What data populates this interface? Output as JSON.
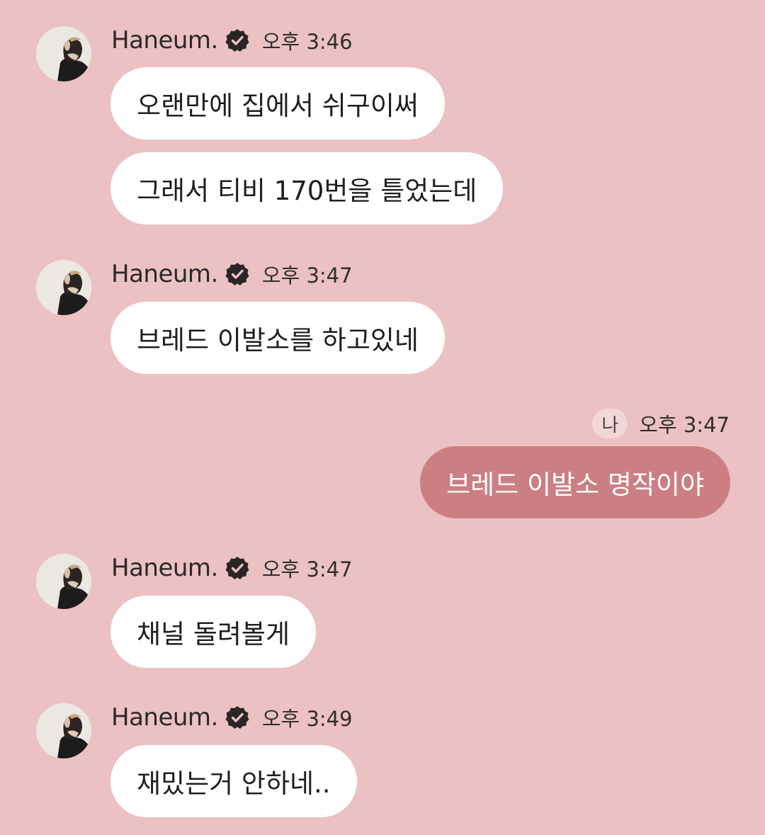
{
  "colors": {
    "background": "#ecc1c4",
    "incoming_bubble": "#ffffff",
    "outgoing_bubble": "#cc7f82",
    "me_label_bg": "#f3d6d8"
  },
  "messages": [
    {
      "sender": "Haneum.",
      "verified_icon": "verified-badge-icon",
      "time": "오후 3:46",
      "bubbles": [
        "오랜만에 집에서 쉬구이써",
        "그래서 티비 170번을 틀었는데"
      ]
    },
    {
      "sender": "Haneum.",
      "verified_icon": "verified-badge-icon",
      "time": "오후 3:47",
      "bubbles": [
        "브레드 이발소를 하고있네"
      ]
    },
    {
      "sender": "나",
      "time": "오후 3:47",
      "bubbles": [
        "브레드 이발소 명작이야"
      ]
    },
    {
      "sender": "Haneum.",
      "verified_icon": "verified-badge-icon",
      "time": "오후 3:47",
      "bubbles": [
        "채널 돌려볼게"
      ]
    },
    {
      "sender": "Haneum.",
      "verified_icon": "verified-badge-icon",
      "time": "오후 3:49",
      "bubbles": [
        "재밌는거 안하네.."
      ]
    }
  ]
}
